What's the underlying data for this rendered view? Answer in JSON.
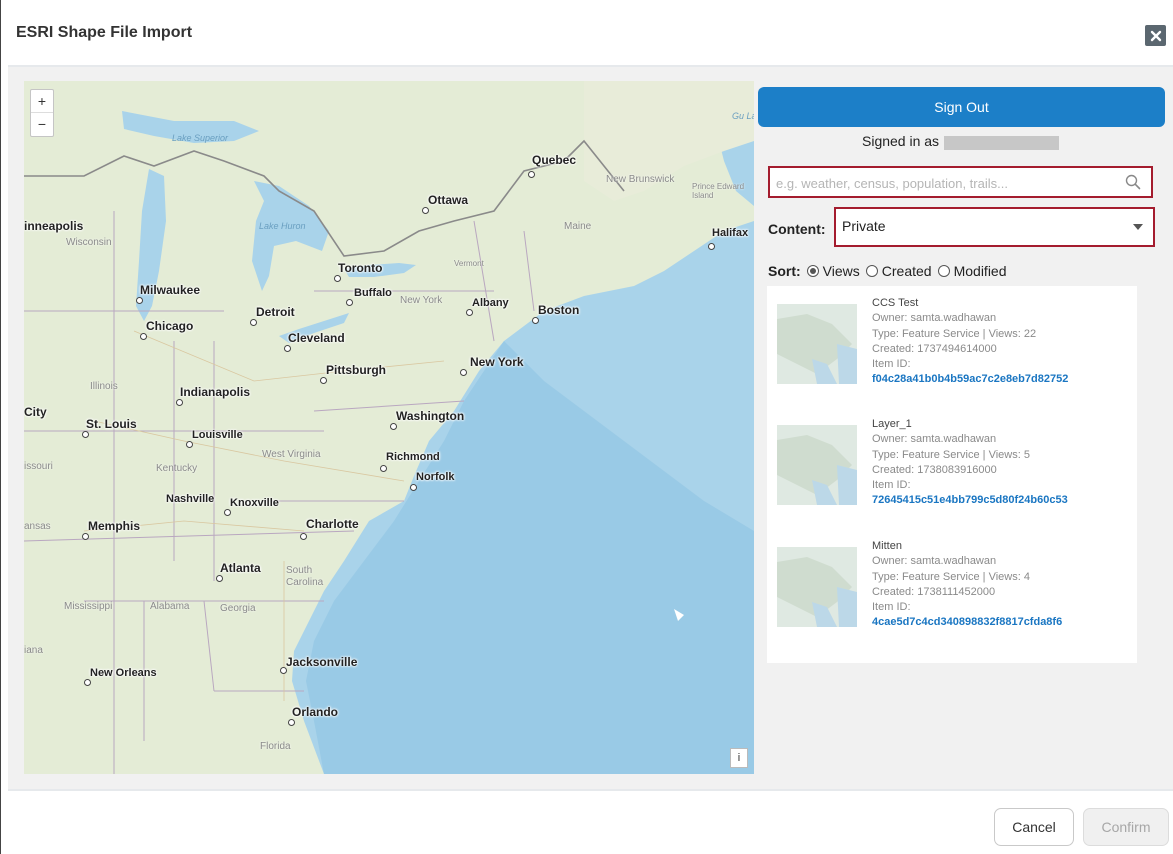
{
  "dialog": {
    "title": "ESRI Shape File Import"
  },
  "map": {
    "zoom_in": "+",
    "zoom_out": "−",
    "info": "i",
    "cities": [
      "Quebec",
      "Ottawa",
      "inneapolis",
      "Halifax",
      "Toronto",
      "Milwaukee",
      "Buffalo",
      "Albany",
      "Boston",
      "Detroit",
      "Chicago",
      "Cleveland",
      "New York",
      "Pittsburgh",
      "Indianapolis",
      "Washington",
      "City",
      "St. Louis",
      "Louisville",
      "Richmond",
      "Norfolk",
      "Nashville",
      "Knoxville",
      "Memphis",
      "Charlotte",
      "Atlanta",
      "Jacksonville",
      "New Orleans",
      "Orlando"
    ],
    "regions": [
      "New Brunswick",
      "Prince Edward Island",
      "Maine",
      "Wisconsin",
      "Vermont",
      "New York",
      "Illinois",
      "West Virginia",
      "Kentucky",
      "issouri",
      "ansas",
      "South Carolina",
      "Mississippi",
      "Alabama",
      "Georgia",
      "iana",
      "Florida"
    ],
    "water": [
      "Lake Superior",
      "Lake Huron",
      "Gu La"
    ]
  },
  "panel": {
    "sign_out": "Sign Out",
    "signed_in_as": "Signed in as",
    "search_placeholder": "e.g. weather, census, population, trails...",
    "content_label": "Content:",
    "content_value": "Private",
    "sort_label": "Sort:",
    "sort_options": [
      "Views",
      "Created",
      "Modified"
    ],
    "sort_selected": "Views",
    "items": [
      {
        "title": "CCS Test",
        "owner": "Owner: samta.wadhawan",
        "type": "Type: Feature Service | Views: 22",
        "created": "Created: 1737494614000",
        "id_label": "Item ID:",
        "id": "f04c28a41b0b4b59ac7c2e8eb7d82752"
      },
      {
        "title": "Layer_1",
        "owner": "Owner: samta.wadhawan",
        "type": "Type: Feature Service | Views: 5",
        "created": "Created: 1738083916000",
        "id_label": "Item ID:",
        "id": "72645415c51e4bb799c5d80f24b60c53"
      },
      {
        "title": "Mitten",
        "owner": "Owner: samta.wadhawan",
        "type": "Type: Feature Service | Views: 4",
        "created": "Created: 1738111452000",
        "id_label": "Item ID:",
        "id": "4cae5d7c4cd340898832f8817cfda8f6"
      }
    ]
  },
  "footer": {
    "cancel": "Cancel",
    "confirm": "Confirm"
  },
  "colors": {
    "accent": "#1c7fc8",
    "highlight_border": "#a41c2e",
    "link": "#1a76c2",
    "water": "#a9d3ea",
    "land": "#e4ecd6"
  },
  "icons": {
    "close": "close-icon",
    "search": "search-icon",
    "dropdown": "chevron-down-icon"
  }
}
